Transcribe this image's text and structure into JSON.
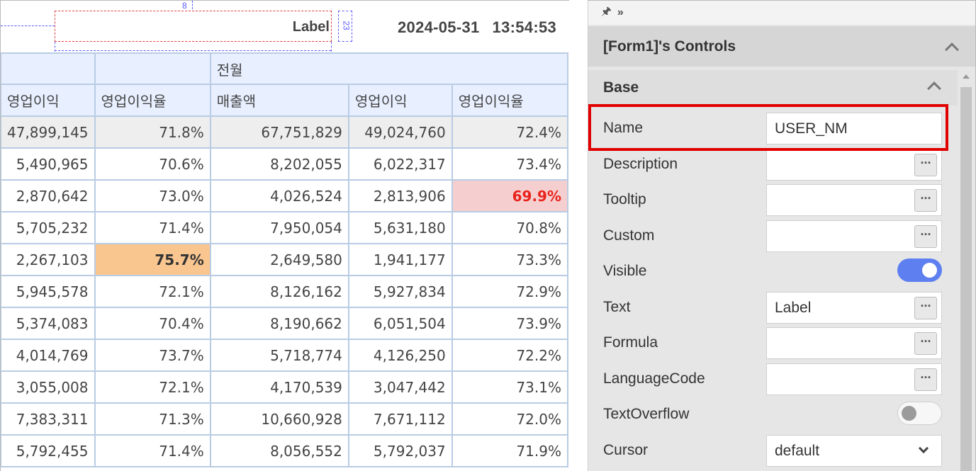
{
  "canvas": {
    "label_text": "Label",
    "dim_top": "8",
    "dim_width": "200",
    "dim_height": "23",
    "date": "2024-05-31",
    "time": "13:54:53",
    "group_header": "전월",
    "columns": [
      "영업이익",
      "영업이익율",
      "매출액",
      "영업이익",
      "영업이익율"
    ],
    "rows": [
      [
        "47,899,145",
        "71.8%",
        "67,751,829",
        "49,024,760",
        "72.4%"
      ],
      [
        "5,490,965",
        "70.6%",
        "8,202,055",
        "6,022,317",
        "73.4%"
      ],
      [
        "2,870,642",
        "73.0%",
        "4,026,524",
        "2,813,906",
        "69.9%"
      ],
      [
        "5,705,232",
        "71.4%",
        "7,950,054",
        "5,631,180",
        "70.8%"
      ],
      [
        "2,267,103",
        "75.7%",
        "2,649,580",
        "1,941,177",
        "73.3%"
      ],
      [
        "5,945,578",
        "72.1%",
        "8,126,162",
        "5,927,834",
        "72.9%"
      ],
      [
        "5,374,083",
        "70.4%",
        "8,190,662",
        "6,051,504",
        "73.9%"
      ],
      [
        "4,014,769",
        "73.7%",
        "5,718,774",
        "4,126,250",
        "72.2%"
      ],
      [
        "3,055,008",
        "72.1%",
        "4,170,539",
        "3,047,442",
        "73.1%"
      ],
      [
        "7,383,311",
        "71.3%",
        "10,660,928",
        "7,671,112",
        "72.0%"
      ],
      [
        "5,792,455",
        "71.4%",
        "8,056,552",
        "5,792,037",
        "71.9%"
      ]
    ],
    "highlight_colors": {
      "low": "#f5cfcf",
      "low_text": "#e8231c",
      "high": "#f9c690"
    }
  },
  "panel": {
    "toolbar_icons": [
      "pin-icon",
      "double-chevron-right-icon"
    ],
    "title": "[Form1]'s Controls",
    "section": "Base",
    "properties": {
      "name": {
        "label": "Name",
        "value": "USER_NM"
      },
      "description": {
        "label": "Description",
        "value": ""
      },
      "tooltip": {
        "label": "Tooltip",
        "value": ""
      },
      "custom": {
        "label": "Custom",
        "value": ""
      },
      "visible": {
        "label": "Visible",
        "on": true
      },
      "text": {
        "label": "Text",
        "value": "Label"
      },
      "formula": {
        "label": "Formula",
        "value": ""
      },
      "language_code": {
        "label": "LanguageCode",
        "value": ""
      },
      "text_overflow": {
        "label": "TextOverflow",
        "on": false
      },
      "cursor": {
        "label": "Cursor",
        "value": "default"
      }
    },
    "button_dots": "···",
    "accent_color": "#5d7ff0",
    "highlight_color": "#e10000"
  }
}
